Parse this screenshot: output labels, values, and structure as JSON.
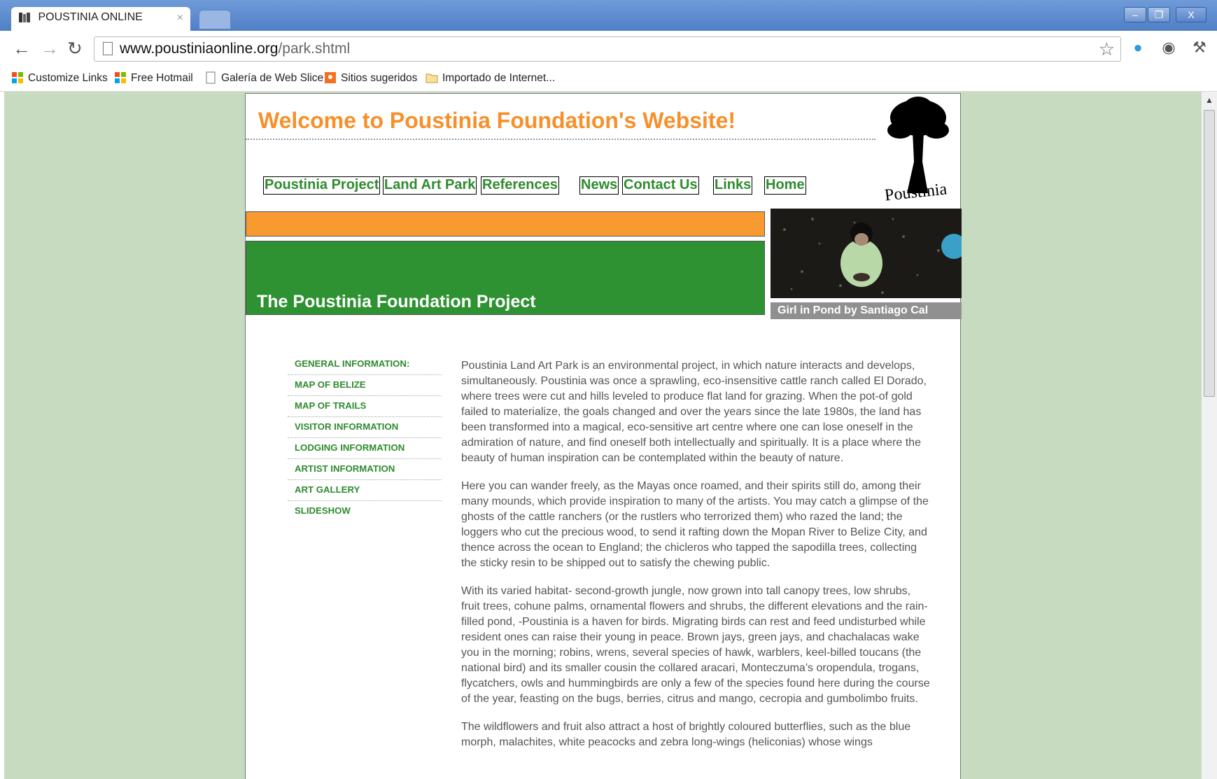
{
  "browser": {
    "tab_title": "POUSTINIA ONLINE",
    "tab_close": "×",
    "window_controls": [
      "–",
      "❐",
      "X"
    ],
    "url_host": "www.poustiniaonline.org",
    "url_path": "/park.shtml",
    "bookmarks": [
      "Customize Links",
      "Free Hotmail",
      "Galería de Web Slice",
      "Sitios sugeridos",
      "Importado de Internet..."
    ]
  },
  "site": {
    "welcome": "Welcome to Poustinia Foundation's Website!",
    "logo_text": "Poustinia",
    "nav": [
      "Poustinia Project",
      "Land Art Park",
      "References",
      "News",
      "Contact Us",
      "Links",
      "Home"
    ],
    "project_title": "The Poustinia Foundation Project",
    "photo_caption": "Girl in Pond by Santiago Cal",
    "side_menu": [
      "GENERAL INFORMATION:",
      "MAP OF BELIZE",
      "MAP OF TRAILS",
      "VISITOR INFORMATION",
      "LODGING INFORMATION",
      "ARTIST INFORMATION",
      "ART GALLERY",
      "SLIDESHOW"
    ],
    "paragraphs": [
      "Poustinia Land Art Park is an environmental project, in which nature interacts and develops, simultaneously. Poustinia was once a sprawling, eco-insensitive cattle ranch called El Dorado, where trees were cut and hills leveled to produce flat land for grazing. When the pot-of gold failed to materialize, the goals changed and over the years since the late 1980s, the land has been transformed into a magical, eco-sensitive art centre where one can lose oneself in the admiration of nature, and find oneself both intellectually and spiritually. It is a place where the beauty of human inspiration can be contemplated within the beauty of nature.",
      "Here you can wander freely, as the Mayas once roamed, and their spirits still do, among their many mounds, which provide inspiration to many of the artists. You may catch a glimpse of the ghosts of the cattle ranchers (or the rustlers who terrorized them) who razed the land; the loggers who cut the precious wood, to send it rafting down the Mopan River to Belize City, and thence across the ocean to England; the chicleros who tapped the sapodilla trees, collecting the sticky resin to be shipped out to satisfy the chewing public.",
      "With its varied habitat- second-growth jungle, now grown into tall canopy trees, low shrubs, fruit trees, cohune palms, ornamental flowers and shrubs, the different elevations and the rain-filled pond, -Poustinia is a haven for birds. Migrating birds can rest and feed undisturbed while resident ones can raise their young in peace. Brown jays, green jays, and chachalacas wake you in the morning; robins, wrens, several species of hawk, warblers, keel-billed toucans (the national bird) and its smaller cousin the collared aracari, Monteczuma’s oropendula, trogans, flycatchers, owls and hummingbirds are only a few of the species found here during the course of the year, feasting on the bugs, berries, citrus and mango, cecropia and gumbolimbo fruits.",
      "The wildflowers and fruit also attract a host of brightly coloured butterflies, such as the blue morph, malachites, white peacocks and zebra long-wings (heliconias) whose wings"
    ]
  },
  "colors": {
    "orange": "#f7902b",
    "green": "#2e9232",
    "page_bg": "#c6dbbf"
  }
}
